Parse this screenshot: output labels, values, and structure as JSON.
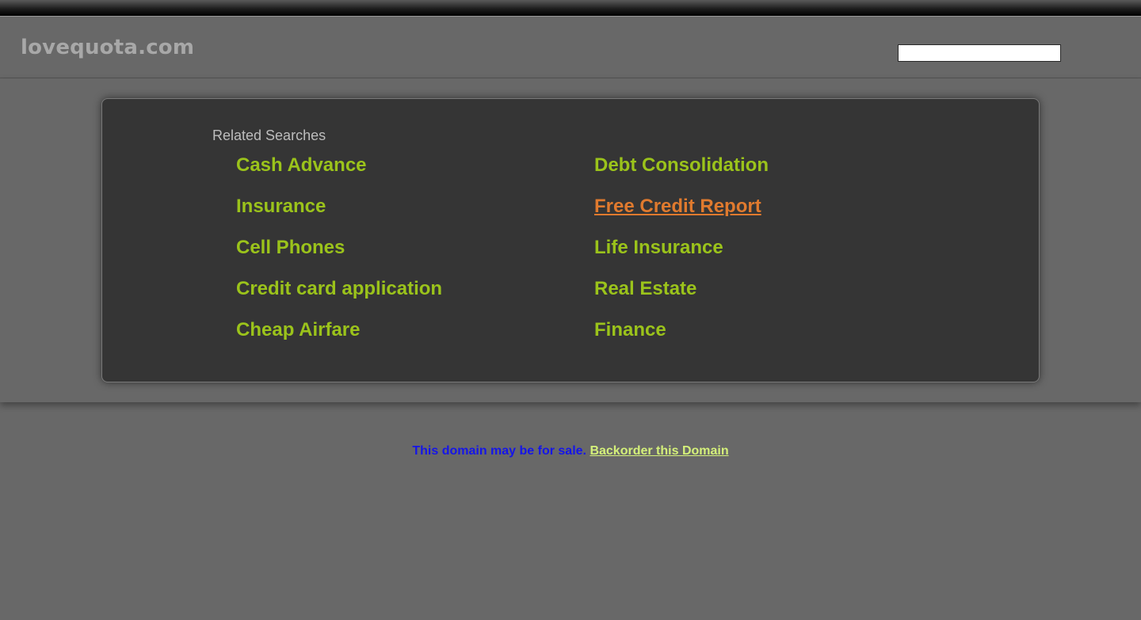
{
  "header": {
    "site_title": "lovequota.com",
    "search": {
      "value": "",
      "placeholder": ""
    }
  },
  "related": {
    "heading": "Related Searches",
    "left_links": [
      "Cash Advance",
      "Insurance",
      "Cell Phones",
      "Credit card application",
      "Cheap Airfare"
    ],
    "right_links": [
      "Debt Consolidation",
      "Free Credit Report",
      "Life Insurance",
      "Real Estate",
      "Finance"
    ],
    "hovered_link": "Free Credit Report"
  },
  "footer": {
    "sale_text": "This domain may be for sale.",
    "backorder_label": "Backorder this Domain"
  },
  "colors": {
    "background": "#686868",
    "panel": "#353535",
    "link": "#9bc31b",
    "link_hover": "#e07a2e",
    "sale_text": "#1515e8",
    "backorder_link": "#d4f07a"
  }
}
